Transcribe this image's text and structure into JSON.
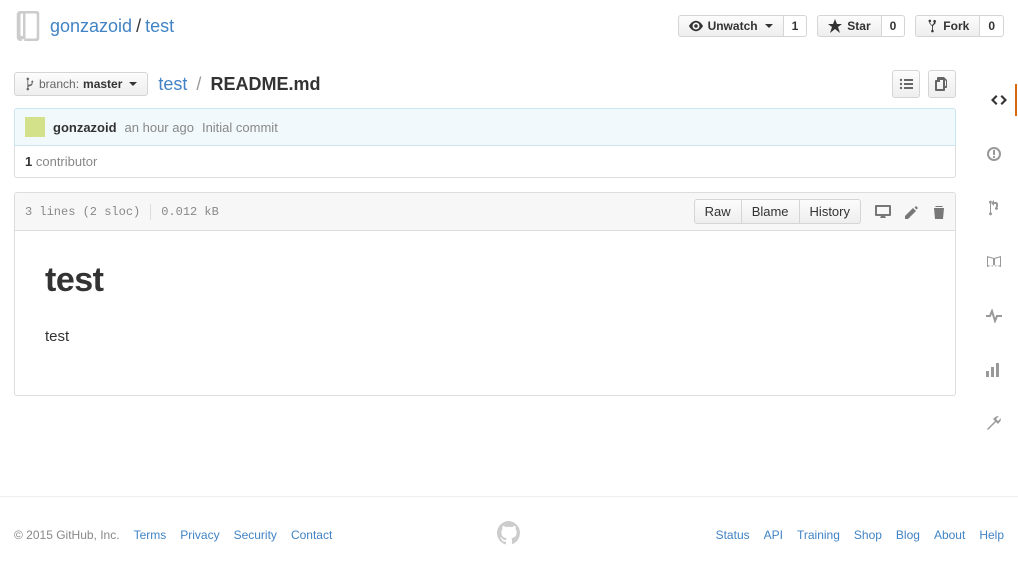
{
  "header": {
    "owner": "gonzazoid",
    "separator": "/",
    "repo": "test",
    "actions": {
      "unwatch": {
        "label": "Unwatch",
        "count": "1"
      },
      "star": {
        "label": "Star",
        "count": "0"
      },
      "fork": {
        "label": "Fork",
        "count": "0"
      }
    }
  },
  "branch": {
    "prefix": "branch:",
    "name": "master"
  },
  "breadcrumb": {
    "root": "test",
    "separator": "/",
    "file": "README.md"
  },
  "commit": {
    "author": "gonzazoid",
    "time": "an hour ago",
    "message": "Initial commit"
  },
  "contributors": {
    "count": "1",
    "label": "contributor"
  },
  "file": {
    "info": {
      "lines": "3 lines (2 sloc)",
      "size": "0.012 kB"
    },
    "actions": {
      "raw": "Raw",
      "blame": "Blame",
      "history": "History"
    },
    "content": {
      "heading": "test",
      "body": "test"
    }
  },
  "footer": {
    "copyright": "© 2015 GitHub, Inc.",
    "left": [
      "Terms",
      "Privacy",
      "Security",
      "Contact"
    ],
    "right": [
      "Status",
      "API",
      "Training",
      "Shop",
      "Blog",
      "About",
      "Help"
    ]
  }
}
